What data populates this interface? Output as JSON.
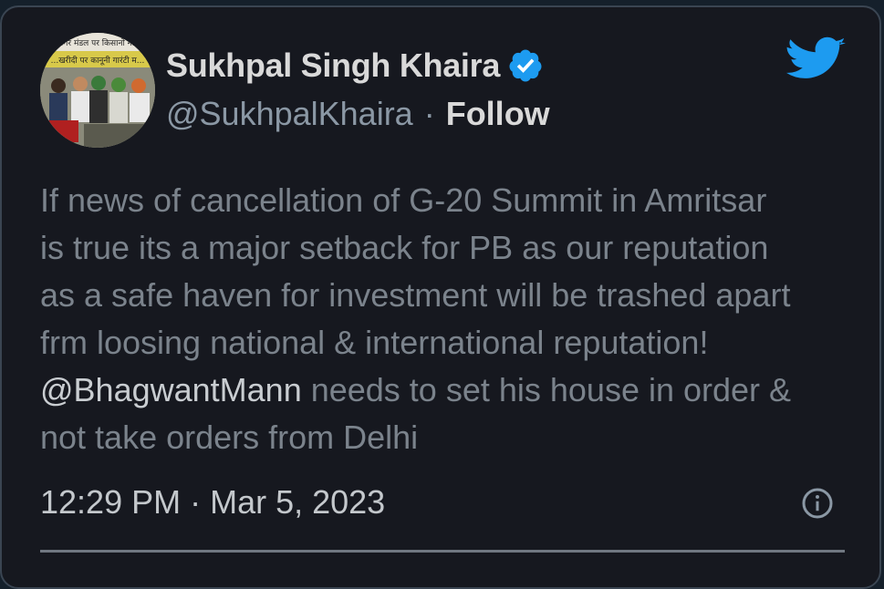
{
  "author": {
    "name": "Sukhpal Singh Khaira",
    "handle": "@SukhpalKhaira",
    "separator": "·",
    "follow_label": "Follow",
    "verified": true,
    "avatar_banner_text_1": "...गर मंडल पर किसानों न...",
    "avatar_banner_text_2": "...खरीदी पर कानूनी गारंटी म..."
  },
  "tweet": {
    "lines": [
      "If news of cancellation of G-20 Summit in Amritsar",
      "is true its a major setback for PB as our reputation",
      "as a safe haven for investment will be trashed apart",
      "frm loosing national & international reputation!"
    ],
    "mention": "@BhagwantMann",
    "line5_rest": " needs to set his house in order &",
    "line6": "not take orders from Delhi"
  },
  "meta": {
    "time": "12:29 PM",
    "separator": "·",
    "date": "Mar 5, 2023"
  },
  "icons": {
    "brand": "twitter-bird-icon",
    "verified": "verified-badge-icon",
    "info": "info-icon"
  },
  "colors": {
    "background": "#16181f",
    "twitter_blue": "#1d9bf0",
    "primary_text": "#d9d9d9",
    "secondary_text": "#8b98a5",
    "body_text": "#7b838c"
  }
}
